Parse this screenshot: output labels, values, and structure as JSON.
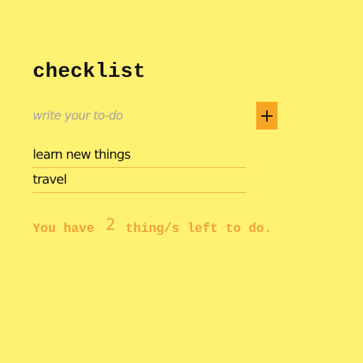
{
  "app": {
    "title": "checklist"
  },
  "form": {
    "input_placeholder": "write your to-do",
    "input_value": "",
    "add_button_label": "+"
  },
  "todos": [
    {
      "text": "learn new things"
    },
    {
      "text": "travel"
    }
  ],
  "counter": {
    "prefix": "You have",
    "count": "2",
    "suffix": "thing/s left to do."
  },
  "colors": {
    "background": "#fff172",
    "accent": "#f6a623",
    "counter_text": "#f0a234",
    "divider": "#f0b433"
  },
  "icons": {
    "add": "plus-icon"
  }
}
